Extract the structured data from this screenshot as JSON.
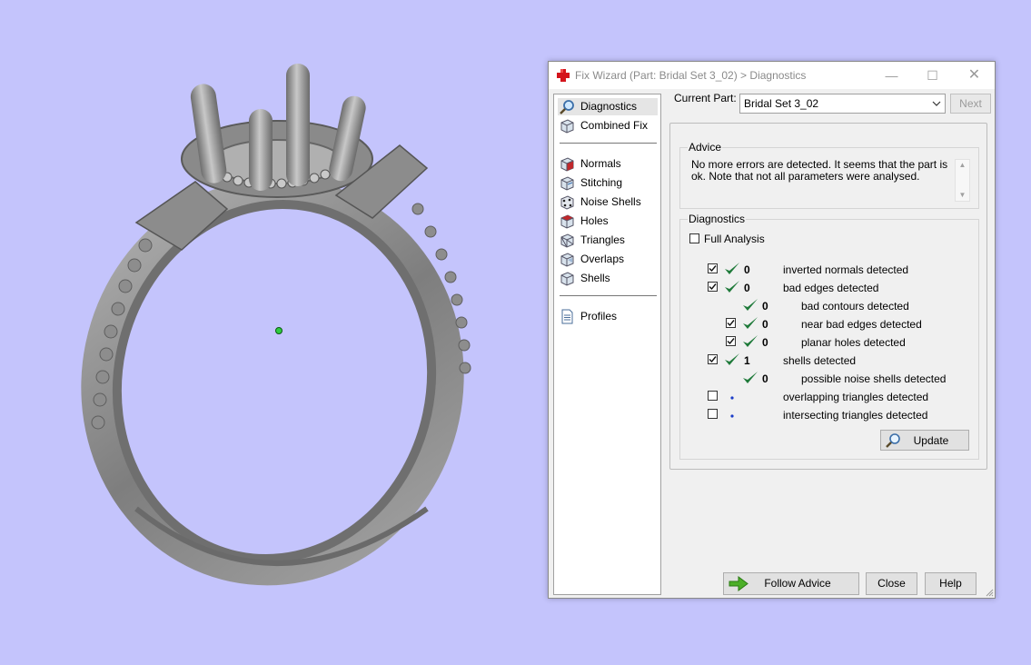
{
  "window": {
    "title": "Fix Wizard (Part: Bridal Set 3_02) > Diagnostics",
    "minimize_glyph": "—",
    "maximize_glyph": "☐",
    "close_glyph": "✕"
  },
  "nav": {
    "items": [
      {
        "label": "Diagnostics",
        "icon": "magnifier-icon",
        "selected": true
      },
      {
        "label": "Combined Fix",
        "icon": "cube-icon"
      },
      {
        "label": "Normals",
        "icon": "normals-cube-icon"
      },
      {
        "label": "Stitching",
        "icon": "stitching-cube-icon"
      },
      {
        "label": "Noise Shells",
        "icon": "noise-shells-icon"
      },
      {
        "label": "Holes",
        "icon": "holes-cube-icon"
      },
      {
        "label": "Triangles",
        "icon": "triangles-cube-icon"
      },
      {
        "label": "Overlaps",
        "icon": "overlaps-cube-icon"
      },
      {
        "label": "Shells",
        "icon": "shells-cube-icon"
      },
      {
        "label": "Profiles",
        "icon": "document-icon"
      }
    ]
  },
  "current_part": {
    "label": "Current Part:",
    "value": "Bridal Set 3_02",
    "next_label": "Next"
  },
  "advice": {
    "title": "Advice",
    "text": "No more errors are detected. It seems that the part is ok. Note that not all parameters were analysed."
  },
  "diagnostics": {
    "title": "Diagnostics",
    "full_analysis_label": "Full Analysis",
    "full_analysis_checked": false,
    "rows": [
      {
        "checkbox": true,
        "checked": true,
        "status": "ok",
        "count": "0",
        "label": "inverted normals detected",
        "indent": 0
      },
      {
        "checkbox": true,
        "checked": true,
        "status": "ok",
        "count": "0",
        "label": "bad edges detected",
        "indent": 0
      },
      {
        "checkbox": false,
        "checked": false,
        "status": "ok",
        "count": "0",
        "label": "bad contours detected",
        "indent": 1
      },
      {
        "checkbox": true,
        "checked": true,
        "status": "ok",
        "count": "0",
        "label": "near bad edges detected",
        "indent": 1
      },
      {
        "checkbox": true,
        "checked": true,
        "status": "ok",
        "count": "0",
        "label": "planar holes detected",
        "indent": 1
      },
      {
        "checkbox": true,
        "checked": true,
        "status": "ok",
        "count": "1",
        "label": "shells detected",
        "indent": 0
      },
      {
        "checkbox": false,
        "checked": false,
        "status": "ok",
        "count": "0",
        "label": "possible noise shells detected",
        "indent": 1
      },
      {
        "checkbox": true,
        "checked": false,
        "status": "none",
        "count": "",
        "label": "overlapping triangles detected",
        "indent": 0
      },
      {
        "checkbox": true,
        "checked": false,
        "status": "none",
        "count": "",
        "label": "intersecting triangles detected",
        "indent": 0
      }
    ],
    "update_label": "Update"
  },
  "footer": {
    "follow_advice_label": "Follow Advice",
    "close_label": "Close",
    "help_label": "Help"
  },
  "colors": {
    "viewport_bg": "#c4c4fc",
    "check_green": "#1f7a3a",
    "model_gray": "#9a9a9a"
  }
}
